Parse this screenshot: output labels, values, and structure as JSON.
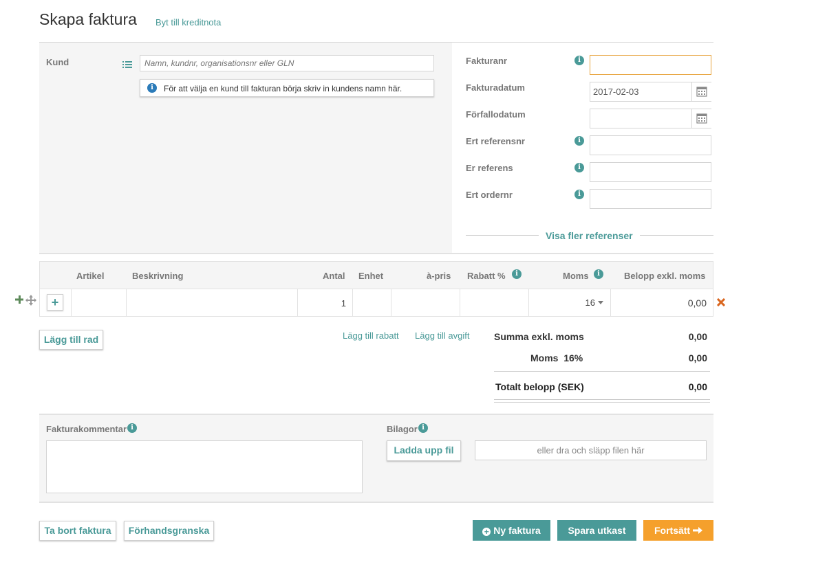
{
  "header": {
    "title": "Skapa faktura",
    "switch_link": "Byt till kreditnota"
  },
  "customer": {
    "label": "Kund",
    "search_placeholder": "Namn, kundnr, organisationsnr eller GLN",
    "hint": "För att välja en kund till fakturan börja skriv in kundens namn här."
  },
  "fields": {
    "invoice_number": {
      "label": "Fakturanr",
      "value": ""
    },
    "invoice_date": {
      "label": "Fakturadatum",
      "value": "2017-02-03"
    },
    "due_date": {
      "label": "Förfallodatum",
      "value": ""
    },
    "your_ref_number": {
      "label": "Ert referensnr",
      "value": ""
    },
    "our_reference": {
      "label": "Er referens",
      "value": ""
    },
    "your_order_number": {
      "label": "Ert ordernr",
      "value": ""
    },
    "more_refs": "Visa fler referenser"
  },
  "table": {
    "headers": {
      "article": "Artikel",
      "description": "Beskrivning",
      "quantity": "Antal",
      "unit": "Enhet",
      "unit_price": "à-pris",
      "discount": "Rabatt %",
      "vat": "Moms",
      "amount": "Belopp exkl. moms"
    },
    "row": {
      "quantity": "1",
      "vat": "16",
      "amount": "0,00"
    }
  },
  "actions": {
    "add_row": "Lägg till rad",
    "add_discount": "Lägg till rabatt",
    "add_fee": "Lägg till avgift"
  },
  "summary": {
    "subtotal_label": "Summa exkl. moms",
    "subtotal_value": "0,00",
    "vat_label": "Moms",
    "vat_rate": "16%",
    "vat_value": "0,00",
    "total_label": "Totalt belopp (SEK)",
    "total_value": "0,00"
  },
  "comment": {
    "label": "Fakturakommentar",
    "value": ""
  },
  "attachments": {
    "label": "Bilagor",
    "upload_button": "Ladda upp fil",
    "drop_hint": "eller dra och släpp filen här"
  },
  "footer": {
    "delete": "Ta bort faktura",
    "preview": "Förhandsgranska",
    "new_invoice": "Ny faktura",
    "save_draft": "Spara utkast",
    "continue": "Fortsätt"
  },
  "colors": {
    "accent": "#4a9a98",
    "orange": "#f5a02c",
    "panel": "#f5f5f5",
    "remove": "#d9661f"
  }
}
